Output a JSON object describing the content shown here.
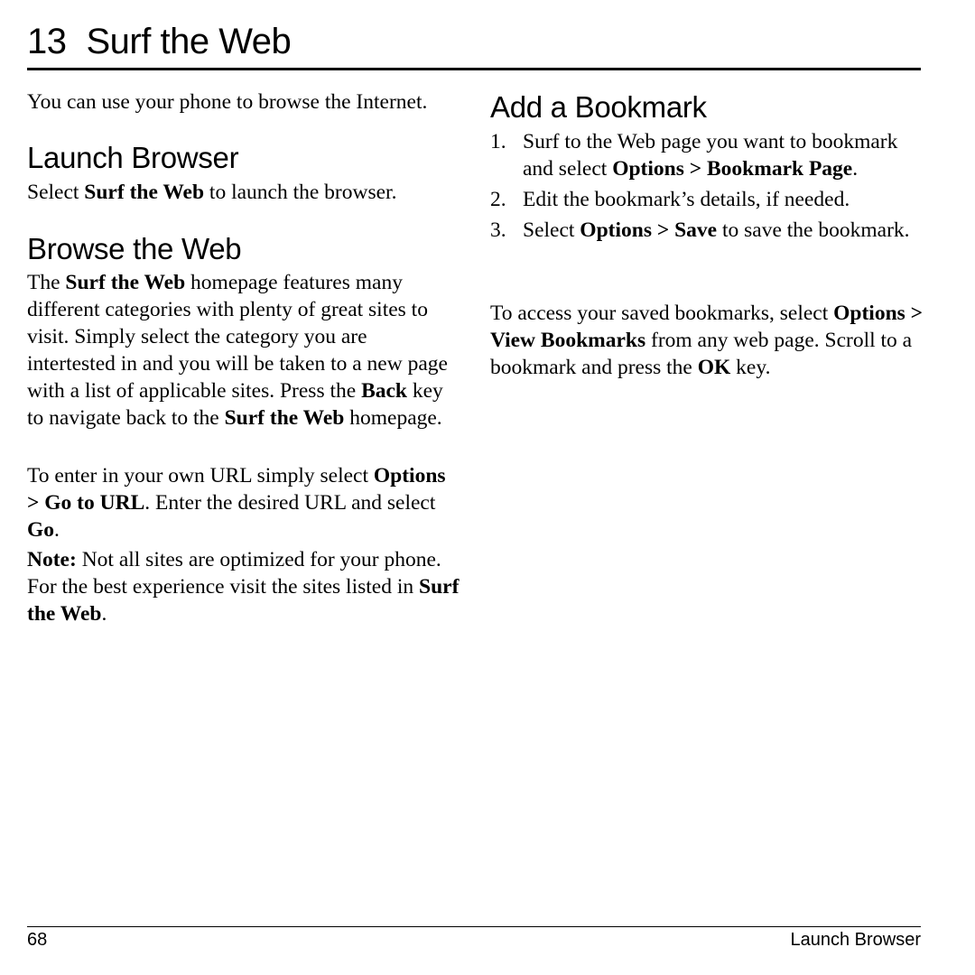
{
  "chapter": {
    "number": "13",
    "title": "Surf the Web"
  },
  "intro": "You can use your phone to browse the Internet.",
  "sections": {
    "launch": {
      "heading": "Launch Browser",
      "p1": {
        "a": "Select ",
        "b1": "Surf the Web",
        "c": " to launch the browser."
      }
    },
    "browse": {
      "heading": "Browse the Web",
      "p1": {
        "a": "The ",
        "b1": "Surf the Web",
        "c": " homepage features many different categories with plenty of great sites to visit. Simply select the category you are intertested in and you will be taken to a new page with a list of applicable sites. Press the ",
        "b2": "Back",
        "d": " key to navigate back to the ",
        "b3": "Surf the Web",
        "e": " homepage."
      },
      "p2": {
        "a": "To enter in your own URL simply select ",
        "b1": "Options > Go to URL",
        "c": ". Enter the desired URL and select ",
        "b2": "Go",
        "d": "."
      },
      "note": {
        "label": "Note:",
        "a": " Not all sites are optimized for your phone. For the best experience visit the sites listed in ",
        "b1": "Surf the Web",
        "c": "."
      }
    },
    "bookmark": {
      "heading": "Add a Bookmark",
      "steps": [
        {
          "num": "1.",
          "a": "Surf to the Web page you want to bookmark and select ",
          "b1": "Options > Bookmark Page",
          "c": "."
        },
        {
          "num": "2.",
          "a": "Edit the bookmark’s details, if needed."
        },
        {
          "num": "3.",
          "a": "Select ",
          "b1": "Options > Save",
          "c": " to save the bookmark."
        }
      ],
      "p1": {
        "a": "To access your saved bookmarks, select ",
        "b1": "Options > View Bookmarks",
        "c": " from any web page. Scroll to a bookmark and press the ",
        "b2": "OK",
        "d": " key."
      }
    }
  },
  "footer": {
    "page_number": "68",
    "section": "Launch Browser"
  }
}
